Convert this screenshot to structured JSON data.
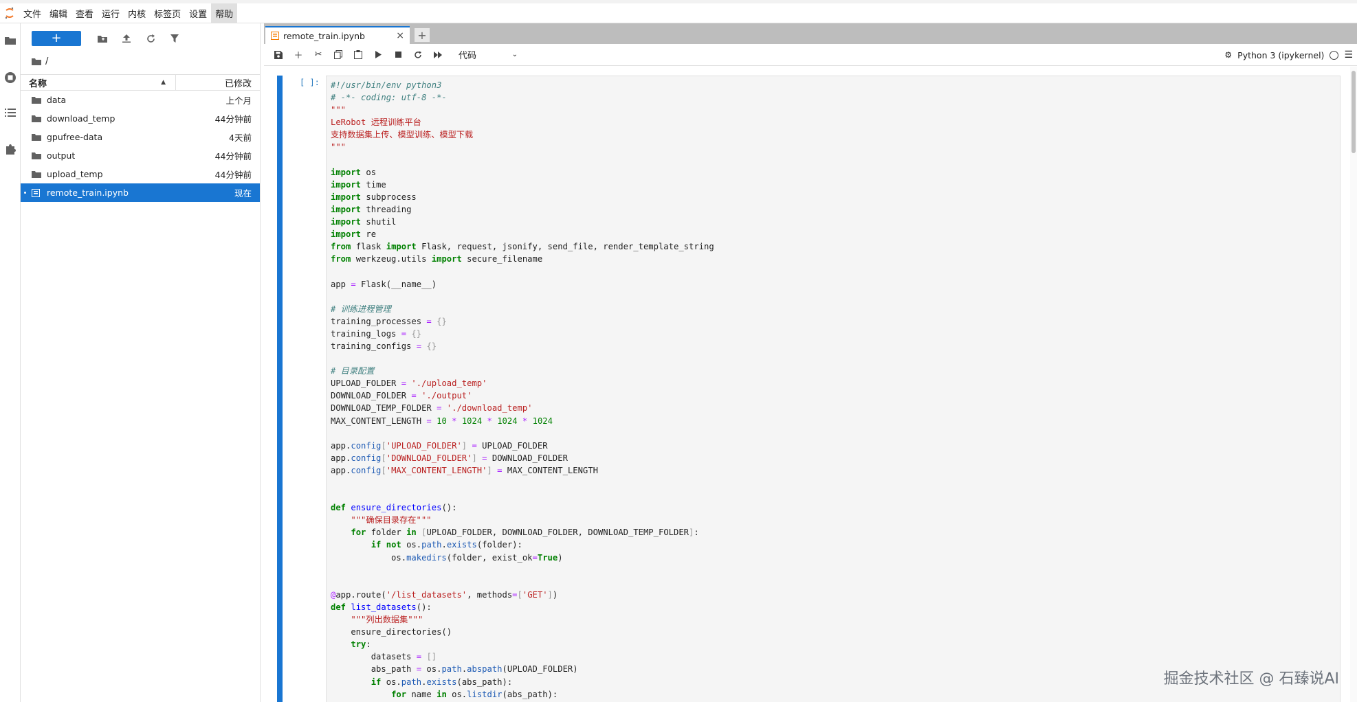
{
  "menu": [
    "文件",
    "编辑",
    "查看",
    "运行",
    "内核",
    "标签页",
    "设置",
    "帮助"
  ],
  "active_menu_index": 7,
  "file_browser": {
    "new_button": "+",
    "breadcrumb": "/",
    "col_name": "名称",
    "col_modified": "已修改",
    "files": [
      {
        "name": "data",
        "modified": "上个月",
        "type": "folder"
      },
      {
        "name": "download_temp",
        "modified": "44分钟前",
        "type": "folder"
      },
      {
        "name": "gpufree-data",
        "modified": "4天前",
        "type": "folder"
      },
      {
        "name": "output",
        "modified": "44分钟前",
        "type": "folder"
      },
      {
        "name": "upload_temp",
        "modified": "44分钟前",
        "type": "folder"
      },
      {
        "name": "remote_train.ipynb",
        "modified": "现在",
        "type": "notebook",
        "selected": true
      }
    ]
  },
  "tab": {
    "label": "remote_train.ipynb",
    "close": "×",
    "add": "+"
  },
  "notebook_toolbar": {
    "cell_type": "代码"
  },
  "kernel": {
    "name": "Python 3 (ipykernel)"
  },
  "cell": {
    "prompt": "[ ]:",
    "lines": [
      [
        [
          "cm",
          "#!/usr/bin/env python3"
        ]
      ],
      [
        [
          "cm",
          "# -*- coding: utf-8 -*-"
        ]
      ],
      [
        [
          "str",
          "\"\"\""
        ]
      ],
      [
        [
          "str",
          "LeRobot 远程训练平台"
        ]
      ],
      [
        [
          "str",
          "支持数据集上传、模型训练、模型下载"
        ]
      ],
      [
        [
          "str",
          "\"\"\""
        ]
      ],
      [],
      [
        [
          "kw",
          "import"
        ],
        [
          "t",
          " os"
        ]
      ],
      [
        [
          "kw",
          "import"
        ],
        [
          "t",
          " time"
        ]
      ],
      [
        [
          "kw",
          "import"
        ],
        [
          "t",
          " subprocess"
        ]
      ],
      [
        [
          "kw",
          "import"
        ],
        [
          "t",
          " threading"
        ]
      ],
      [
        [
          "kw",
          "import"
        ],
        [
          "t",
          " shutil"
        ]
      ],
      [
        [
          "kw",
          "import"
        ],
        [
          "t",
          " re"
        ]
      ],
      [
        [
          "kw",
          "from"
        ],
        [
          "t",
          " flask "
        ],
        [
          "kw",
          "import"
        ],
        [
          "t",
          " Flask, request, jsonify, send_file, render_template_string"
        ]
      ],
      [
        [
          "kw",
          "from"
        ],
        [
          "t",
          " werkzeug.utils "
        ],
        [
          "kw",
          "import"
        ],
        [
          "t",
          " secure_filename"
        ]
      ],
      [],
      [
        [
          "t",
          "app "
        ],
        [
          "op",
          "="
        ],
        [
          "t",
          " Flask(__name__)"
        ]
      ],
      [],
      [
        [
          "cm",
          "# 训练进程管理"
        ]
      ],
      [
        [
          "t",
          "training_processes "
        ],
        [
          "op",
          "="
        ],
        [
          "t",
          " "
        ],
        [
          "br",
          "{}"
        ]
      ],
      [
        [
          "t",
          "training_logs "
        ],
        [
          "op",
          "="
        ],
        [
          "t",
          " "
        ],
        [
          "br",
          "{}"
        ]
      ],
      [
        [
          "t",
          "training_configs "
        ],
        [
          "op",
          "="
        ],
        [
          "t",
          " "
        ],
        [
          "br",
          "{}"
        ]
      ],
      [],
      [
        [
          "cm",
          "# 目录配置"
        ]
      ],
      [
        [
          "t",
          "UPLOAD_FOLDER "
        ],
        [
          "op",
          "="
        ],
        [
          "t",
          " "
        ],
        [
          "str",
          "'./upload_temp'"
        ]
      ],
      [
        [
          "t",
          "DOWNLOAD_FOLDER "
        ],
        [
          "op",
          "="
        ],
        [
          "t",
          " "
        ],
        [
          "str",
          "'./output'"
        ]
      ],
      [
        [
          "t",
          "DOWNLOAD_TEMP_FOLDER "
        ],
        [
          "op",
          "="
        ],
        [
          "t",
          " "
        ],
        [
          "str",
          "'./download_temp'"
        ]
      ],
      [
        [
          "t",
          "MAX_CONTENT_LENGTH "
        ],
        [
          "op",
          "="
        ],
        [
          "t",
          " "
        ],
        [
          "num",
          "10"
        ],
        [
          "t",
          " "
        ],
        [
          "op",
          "*"
        ],
        [
          "t",
          " "
        ],
        [
          "num",
          "1024"
        ],
        [
          "t",
          " "
        ],
        [
          "op",
          "*"
        ],
        [
          "t",
          " "
        ],
        [
          "num",
          "1024"
        ],
        [
          "t",
          " "
        ],
        [
          "op",
          "*"
        ],
        [
          "t",
          " "
        ],
        [
          "num",
          "1024"
        ]
      ],
      [],
      [
        [
          "t",
          "app."
        ],
        [
          "attr",
          "config"
        ],
        [
          "br",
          "["
        ],
        [
          "str",
          "'UPLOAD_FOLDER'"
        ],
        [
          "br",
          "]"
        ],
        [
          "t",
          " "
        ],
        [
          "op",
          "="
        ],
        [
          "t",
          " UPLOAD_FOLDER"
        ]
      ],
      [
        [
          "t",
          "app."
        ],
        [
          "attr",
          "config"
        ],
        [
          "br",
          "["
        ],
        [
          "str",
          "'DOWNLOAD_FOLDER'"
        ],
        [
          "br",
          "]"
        ],
        [
          "t",
          " "
        ],
        [
          "op",
          "="
        ],
        [
          "t",
          " DOWNLOAD_FOLDER"
        ]
      ],
      [
        [
          "t",
          "app."
        ],
        [
          "attr",
          "config"
        ],
        [
          "br",
          "["
        ],
        [
          "str",
          "'MAX_CONTENT_LENGTH'"
        ],
        [
          "br",
          "]"
        ],
        [
          "t",
          " "
        ],
        [
          "op",
          "="
        ],
        [
          "t",
          " MAX_CONTENT_LENGTH"
        ]
      ],
      [],
      [],
      [
        [
          "kw",
          "def"
        ],
        [
          "t",
          " "
        ],
        [
          "def",
          "ensure_directories"
        ],
        [
          "t",
          "():"
        ]
      ],
      [
        [
          "t",
          "    "
        ],
        [
          "str",
          "\"\"\"确保目录存在\"\"\""
        ]
      ],
      [
        [
          "t",
          "    "
        ],
        [
          "kw",
          "for"
        ],
        [
          "t",
          " folder "
        ],
        [
          "kw",
          "in"
        ],
        [
          "t",
          " "
        ],
        [
          "br",
          "["
        ],
        [
          "t",
          "UPLOAD_FOLDER, DOWNLOAD_FOLDER, DOWNLOAD_TEMP_FOLDER"
        ],
        [
          "br",
          "]"
        ],
        [
          "t",
          ":"
        ]
      ],
      [
        [
          "t",
          "        "
        ],
        [
          "kw",
          "if"
        ],
        [
          "t",
          " "
        ],
        [
          "kw",
          "not"
        ],
        [
          "t",
          " os."
        ],
        [
          "attr",
          "path"
        ],
        [
          "t",
          "."
        ],
        [
          "attr",
          "exists"
        ],
        [
          "t",
          "(folder):"
        ]
      ],
      [
        [
          "t",
          "            os."
        ],
        [
          "attr",
          "makedirs"
        ],
        [
          "t",
          "(folder, exist_ok"
        ],
        [
          "op",
          "="
        ],
        [
          "kw",
          "True"
        ],
        [
          "t",
          ")"
        ]
      ],
      [],
      [],
      [
        [
          "dec",
          "@"
        ],
        [
          "t",
          "app.route("
        ],
        [
          "str",
          "'/list_datasets'"
        ],
        [
          "t",
          ", methods"
        ],
        [
          "op",
          "="
        ],
        [
          "br",
          "["
        ],
        [
          "str",
          "'GET'"
        ],
        [
          "br",
          "]"
        ],
        [
          "t",
          ")"
        ]
      ],
      [
        [
          "kw",
          "def"
        ],
        [
          "t",
          " "
        ],
        [
          "def",
          "list_datasets"
        ],
        [
          "t",
          "():"
        ]
      ],
      [
        [
          "t",
          "    "
        ],
        [
          "str",
          "\"\"\"列出数据集\"\"\""
        ]
      ],
      [
        [
          "t",
          "    ensure_directories()"
        ]
      ],
      [
        [
          "t",
          "    "
        ],
        [
          "kw",
          "try"
        ],
        [
          "t",
          ":"
        ]
      ],
      [
        [
          "t",
          "        datasets "
        ],
        [
          "op",
          "="
        ],
        [
          "t",
          " "
        ],
        [
          "br",
          "[]"
        ]
      ],
      [
        [
          "t",
          "        abs_path "
        ],
        [
          "op",
          "="
        ],
        [
          "t",
          " os."
        ],
        [
          "attr",
          "path"
        ],
        [
          "t",
          "."
        ],
        [
          "attr",
          "abspath"
        ],
        [
          "t",
          "(UPLOAD_FOLDER)"
        ]
      ],
      [
        [
          "t",
          "        "
        ],
        [
          "kw",
          "if"
        ],
        [
          "t",
          " os."
        ],
        [
          "attr",
          "path"
        ],
        [
          "t",
          "."
        ],
        [
          "attr",
          "exists"
        ],
        [
          "t",
          "(abs_path):"
        ]
      ],
      [
        [
          "t",
          "            "
        ],
        [
          "kw",
          "for"
        ],
        [
          "t",
          " name "
        ],
        [
          "kw",
          "in"
        ],
        [
          "t",
          " os."
        ],
        [
          "attr",
          "listdir"
        ],
        [
          "t",
          "(abs_path):"
        ]
      ]
    ]
  },
  "watermark": "掘金技术社区 @ 石臻说AI"
}
